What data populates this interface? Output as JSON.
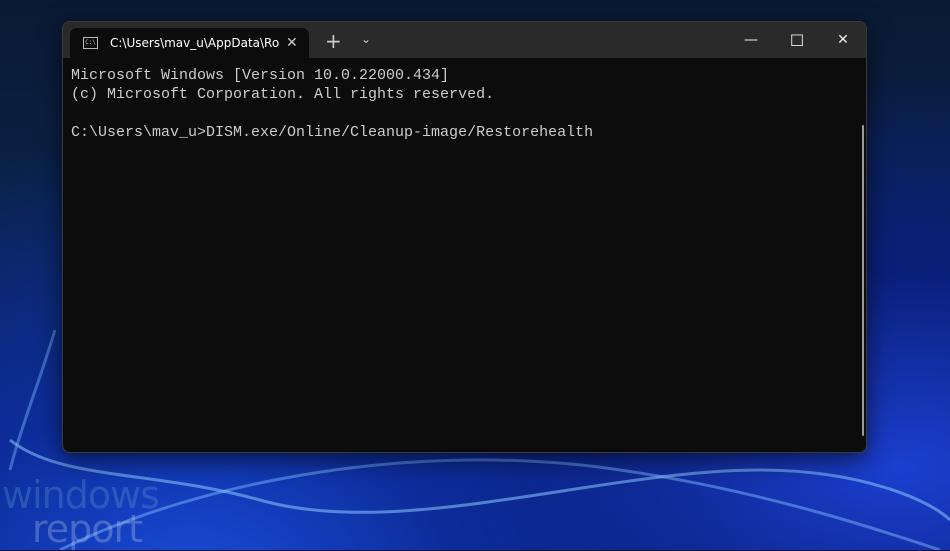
{
  "window": {
    "tab_title": "C:\\Users\\mav_u\\AppData\\Roam",
    "tab_icon": "C:\\",
    "new_tab": "+",
    "dropdown": "⌄",
    "close_tab": "✕",
    "minimize": "—",
    "maximize": "☐",
    "close": "✕"
  },
  "terminal": {
    "lines": [
      "Microsoft Windows [Version 10.0.22000.434]",
      "(c) Microsoft Corporation. All rights reserved.",
      "",
      "C:\\Users\\mav_u>DISM.exe/Online/Cleanup-image/Restorehealth"
    ]
  },
  "watermark": {
    "line1": "windows",
    "line2": "report"
  }
}
